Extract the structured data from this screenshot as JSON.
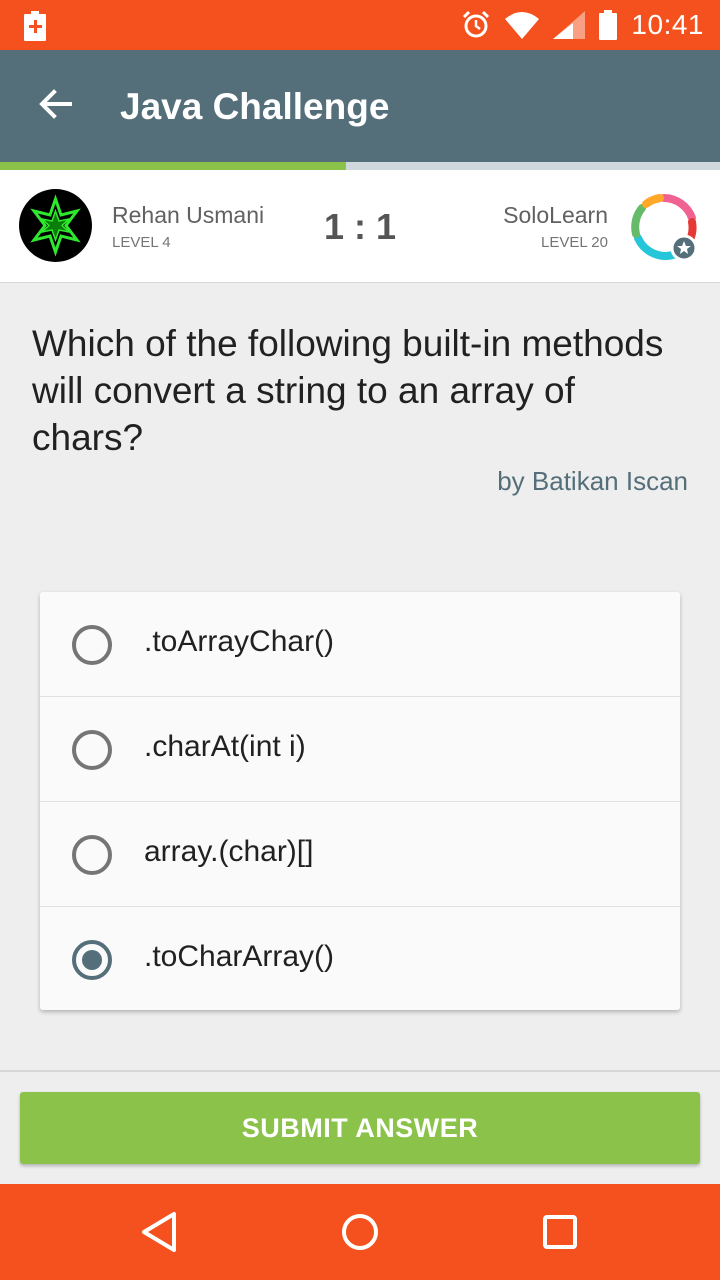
{
  "status_bar": {
    "time": "10:41",
    "icons": [
      "battery-alert-icon",
      "alarm-icon",
      "wifi-icon",
      "signal-icon",
      "battery-icon"
    ]
  },
  "app_bar": {
    "title": "Java Challenge",
    "back_icon": "arrow-left-icon"
  },
  "progress": {
    "value": 0.48,
    "color": "#8bc34a"
  },
  "players": {
    "left": {
      "name": "Rehan Usmani",
      "level": "LEVEL 4"
    },
    "score": "1 : 1",
    "right": {
      "name": "SoloLearn",
      "level": "LEVEL 20"
    }
  },
  "question": {
    "text": "Which of the following built-in methods will convert a string to an array of chars?",
    "author": "by Batikan Iscan"
  },
  "options": [
    {
      "label": ".toArrayChar()",
      "selected": false
    },
    {
      "label": ".charAt(int i)",
      "selected": false
    },
    {
      "label": "array.(char)[]",
      "selected": false
    },
    {
      "label": ".toCharArray()",
      "selected": true
    }
  ],
  "submit": {
    "label": "SUBMIT ANSWER"
  },
  "nav_bar": {
    "icons": [
      "back-triangle-icon",
      "home-circle-icon",
      "recents-square-icon"
    ]
  },
  "colors": {
    "status_bar": "#f4511e",
    "app_bar": "#546e7a",
    "accent": "#8bc34a"
  }
}
